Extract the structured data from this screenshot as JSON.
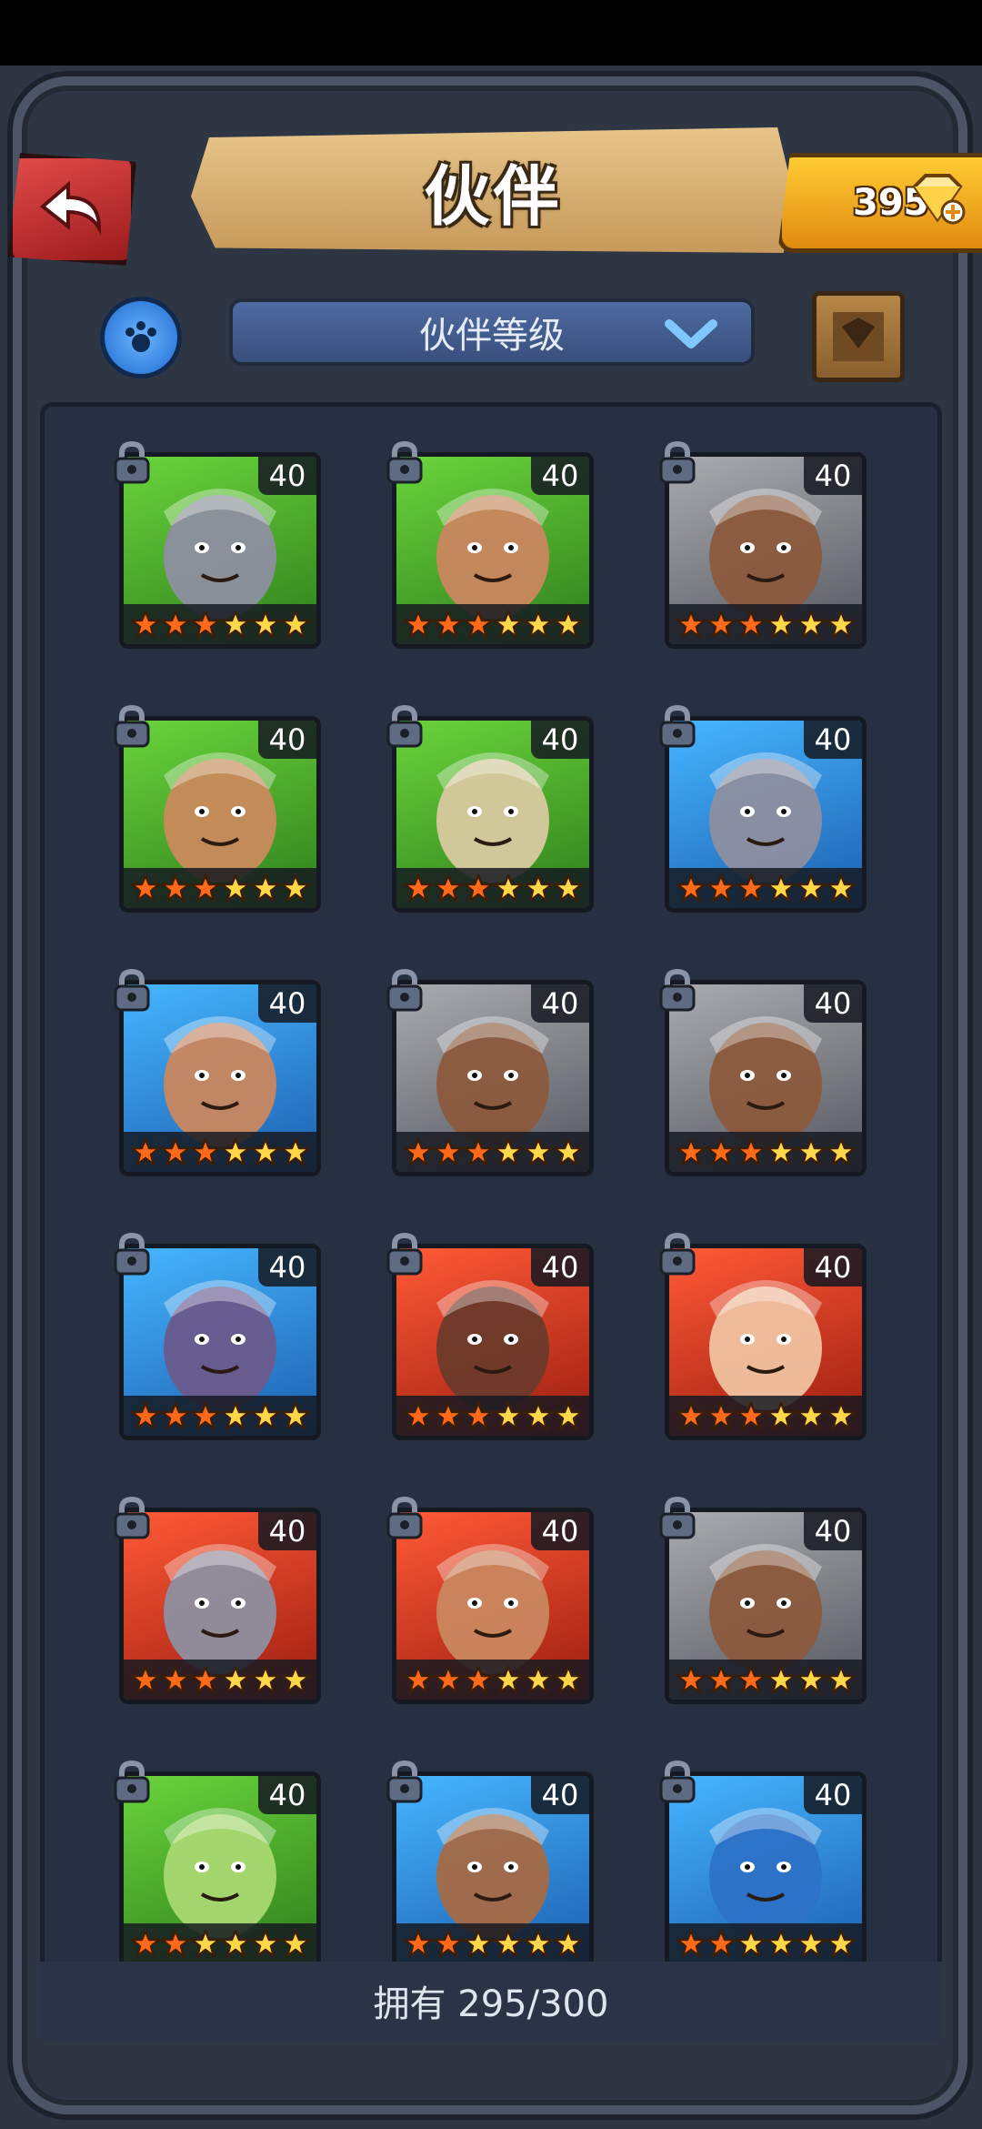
{
  "header": {
    "title": "伙伴",
    "gems": "395"
  },
  "filter": {
    "sort_label": "伙伴等级"
  },
  "footer": {
    "owned_text": "拥有 295/300"
  },
  "colors": {
    "green": "#46a82a",
    "blue": "#2f8fd8",
    "red": "#c8331f",
    "gray": "#7d7f86",
    "star_filled": "#ff6a1a",
    "star_empty": "#ffd84a"
  },
  "heroes": [
    {
      "level": "40",
      "bg": "green",
      "stars_filled": 3,
      "stars_total": 6,
      "portrait": "elephant-beast"
    },
    {
      "level": "40",
      "bg": "green",
      "stars_filled": 3,
      "stars_total": 6,
      "portrait": "skull-huntress"
    },
    {
      "level": "40",
      "bg": "gray",
      "stars_filled": 3,
      "stars_total": 6,
      "portrait": "spiked-brute"
    },
    {
      "level": "40",
      "bg": "green",
      "stars_filled": 3,
      "stars_total": 6,
      "portrait": "bandana-warrior"
    },
    {
      "level": "40",
      "bg": "green",
      "stars_filled": 3,
      "stars_total": 6,
      "portrait": "witch-cat"
    },
    {
      "level": "40",
      "bg": "blue",
      "stars_filled": 3,
      "stars_total": 6,
      "portrait": "elephant-beast"
    },
    {
      "level": "40",
      "bg": "blue",
      "stars_filled": 3,
      "stars_total": 6,
      "portrait": "skull-huntress"
    },
    {
      "level": "40",
      "bg": "gray",
      "stars_filled": 3,
      "stars_total": 6,
      "portrait": "spiked-brute"
    },
    {
      "level": "40",
      "bg": "gray",
      "stars_filled": 3,
      "stars_total": 6,
      "portrait": "spiked-brute"
    },
    {
      "level": "40",
      "bg": "blue",
      "stars_filled": 3,
      "stars_total": 6,
      "portrait": "hooded-mage"
    },
    {
      "level": "40",
      "bg": "red",
      "stars_filled": 3,
      "stars_total": 6,
      "portrait": "red-hood-assassin"
    },
    {
      "level": "40",
      "bg": "red",
      "stars_filled": 3,
      "stars_total": 6,
      "portrait": "skull-priestess"
    },
    {
      "level": "40",
      "bg": "red",
      "stars_filled": 3,
      "stars_total": 6,
      "portrait": "elephant-beast"
    },
    {
      "level": "40",
      "bg": "red",
      "stars_filled": 3,
      "stars_total": 6,
      "portrait": "skull-huntress"
    },
    {
      "level": "40",
      "bg": "gray",
      "stars_filled": 3,
      "stars_total": 6,
      "portrait": "spiked-brute"
    },
    {
      "level": "40",
      "bg": "green",
      "stars_filled": 2,
      "stars_total": 6,
      "portrait": "frog-creature"
    },
    {
      "level": "40",
      "bg": "blue",
      "stars_filled": 2,
      "stars_total": 6,
      "portrait": "mustache-warrior"
    },
    {
      "level": "40",
      "bg": "blue",
      "stars_filled": 2,
      "stars_total": 6,
      "portrait": "horned-beast"
    }
  ]
}
